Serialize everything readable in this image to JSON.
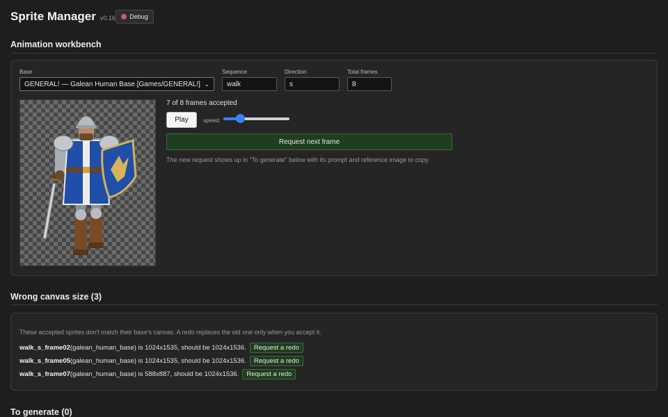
{
  "header": {
    "title": "Sprite Manager",
    "version": "v0.16.0",
    "debug_label": "Debug"
  },
  "workbench": {
    "title": "Animation workbench",
    "base_label": "Base",
    "base_value": "GENERAL! — Galean Human Base [Games/GENERAL!]",
    "sequence_label": "Sequence",
    "sequence_value": "walk",
    "direction_label": "Direction",
    "direction_value": "s",
    "total_frames_label": "Total frames",
    "total_frames_value": "8",
    "status": "7 of 8 frames accepted",
    "play_label": "Play",
    "speed_label": "speed",
    "speed_level": 0.25,
    "request_label": "Request next frame",
    "hint": "The new request shows up in \"To generate\" below with its prompt and reference image to copy."
  },
  "wrong_canvas": {
    "title": "Wrong canvas size (3)",
    "intro": "These accepted sprites don't match their base's canvas. A redo replaces the old one only when you accept it.",
    "rows": [
      {
        "name": "walk_s_frame02",
        "detail": " (galean_human_base) is 1024x1535, should be 1024x1536.",
        "button": "Request a redo"
      },
      {
        "name": "walk_s_frame05",
        "detail": " (galean_human_base) is 1024x1535, should be 1024x1536.",
        "button": "Request a redo"
      },
      {
        "name": "walk_s_frame07",
        "detail": " (galean_human_base) is 588x887, should be 1024x1536.",
        "button": "Request a redo"
      }
    ]
  },
  "to_generate": {
    "title": "To generate (0)"
  },
  "colors": {
    "background": "#1e1e1e",
    "panel": "#252525",
    "accent_green": "#1f3d1f",
    "slider_blue": "#3b82f6",
    "tunic_blue": "#1f4fa8"
  }
}
